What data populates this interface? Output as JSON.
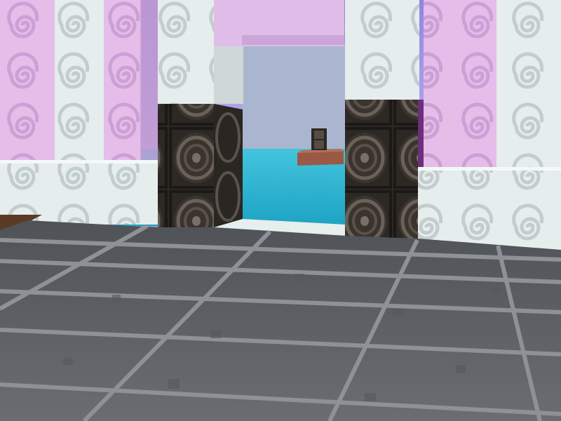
{
  "scene": {
    "type": "voxel-game-first-person-view",
    "colors": {
      "sky": "#9b90e6",
      "sky_horizon": "#b4abf0",
      "sea": "#34b6d3",
      "sea_deep": "#1f9fbf",
      "white_block": "#e4ecec",
      "white_block_shadow": "#b9c3c3",
      "swirl": "#c9d3d3",
      "pink_block": "#e2b8e8",
      "pink_swirl": "#c89ad2",
      "speaker": "#2e2a26",
      "speaker_ring": "#6b6158",
      "floor": "#5f6266",
      "floor_grout": "#9a9ea3",
      "wood_platform": "#9c5a44",
      "purple_block": "#6e2f7c"
    }
  }
}
